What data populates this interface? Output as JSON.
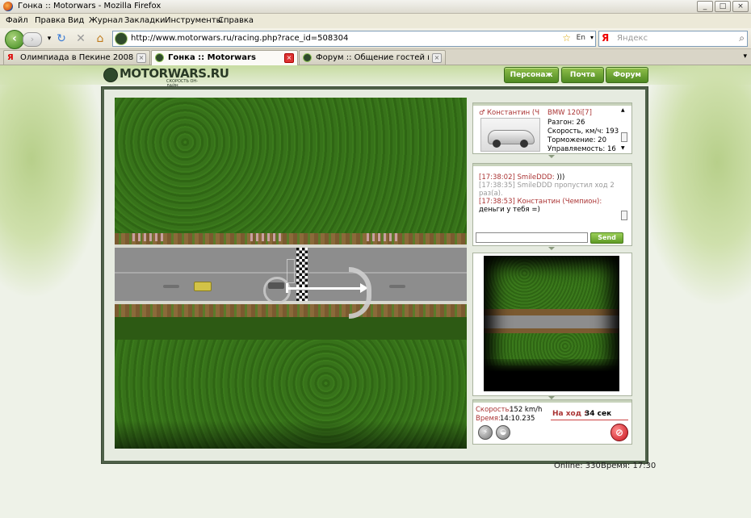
{
  "window": {
    "title": "Гонка :: Motorwars - Mozilla Firefox"
  },
  "menu": [
    "Файл",
    "Правка",
    "Вид",
    "Журнал",
    "Закладки",
    "Инструменты",
    "Справка"
  ],
  "toolbar": {
    "url": "http://www.motorwars.ru/racing.php?race_id=508304",
    "lang_badge": "En",
    "search_placeholder": "Яндекс",
    "search_logo": "Я"
  },
  "tabs": [
    {
      "label": "Олимпиада в Пекине 2008",
      "icon": "yandex-icon",
      "active": false
    },
    {
      "label": "Гонка :: Motorwars",
      "icon": "motorwars-icon",
      "active": true
    },
    {
      "label": "Форум :: Общение гостей игры :: \"...",
      "icon": "motorwars-icon",
      "active": false
    }
  ],
  "site": {
    "logo": "MOTORWARS.RU",
    "logo_sub": "СКОРОСТЬ  ОН-ЛАЙН",
    "nav": [
      "Персонаж",
      "Почта",
      "Форум"
    ]
  },
  "player": {
    "name": "Константин (Ч",
    "car_model": "BMW 120i[7]",
    "stats": [
      "Разгон: 26",
      "Скорость, км/ч: 193",
      "Торможение: 20",
      "Управляемость: 16"
    ]
  },
  "chat": {
    "lines": [
      {
        "time": "[17:38:02]",
        "who": "SmileDDD:",
        "text": ")))",
        "style": "normal"
      },
      {
        "time": "[17:38:35]",
        "who": "SmileDDD",
        "text": "пропустил ход 2 раз(а).",
        "style": "gray"
      },
      {
        "time": "[17:38:53]",
        "who": "Константин (Чемпион):",
        "text": "деньги у тебя =)",
        "style": "normal"
      }
    ],
    "input_value": "",
    "send_label": "Send"
  },
  "race": {
    "speed_label": "Скорость:",
    "speed_value": "152 km/h",
    "time_label": "Время:",
    "time_value": "14:10.235",
    "turn_label": "На ход :",
    "turn_value": "34 сек"
  },
  "footer": {
    "online": "Online: 330",
    "time": "Время: 17:30"
  },
  "colors": {
    "brand_green": "#4f8a22",
    "frame": "#4e6048",
    "accent_red": "#a33333"
  }
}
